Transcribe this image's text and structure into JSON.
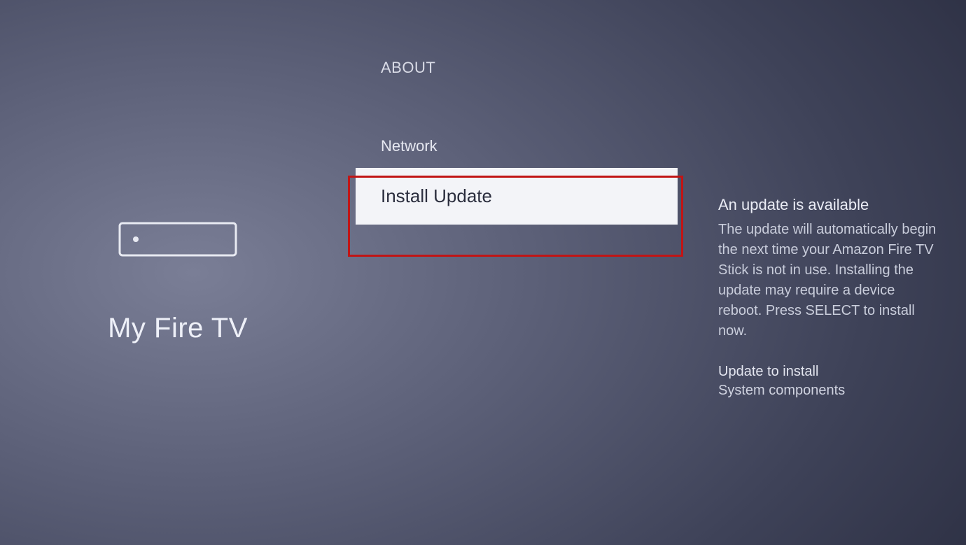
{
  "left": {
    "title": "My Fire TV"
  },
  "middle": {
    "section_header": "ABOUT",
    "items": [
      {
        "label": "Network",
        "selected": false
      },
      {
        "label": "Install Update",
        "selected": true
      }
    ]
  },
  "right": {
    "info_title": "An update is available",
    "info_body": "The update will automatically begin the next time your Amazon Fire TV Stick is not in use. Installing the update may require a device reboot. Press SELECT to install now.",
    "sub_title": "Update to install",
    "sub_value": "System components"
  }
}
